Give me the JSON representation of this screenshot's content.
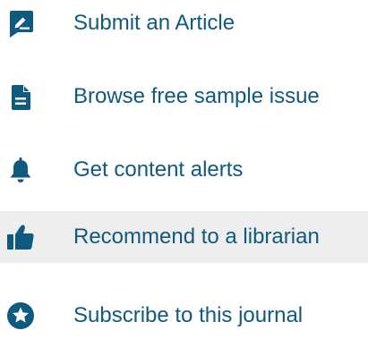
{
  "colors": {
    "icon": "#10597f",
    "link": "#10597f",
    "highlight_bg": "#eeeeee"
  },
  "menu": {
    "items": [
      {
        "label": "Submit an Article",
        "icon": "edit-pen-icon"
      },
      {
        "label": "Browse free sample issue",
        "icon": "document-icon"
      },
      {
        "label": "Get content alerts",
        "icon": "bell-icon"
      },
      {
        "label": "Recommend to a librarian",
        "icon": "thumbs-up-icon",
        "highlighted": true
      },
      {
        "label": "Subscribe to this journal",
        "icon": "star-badge-icon"
      }
    ]
  }
}
